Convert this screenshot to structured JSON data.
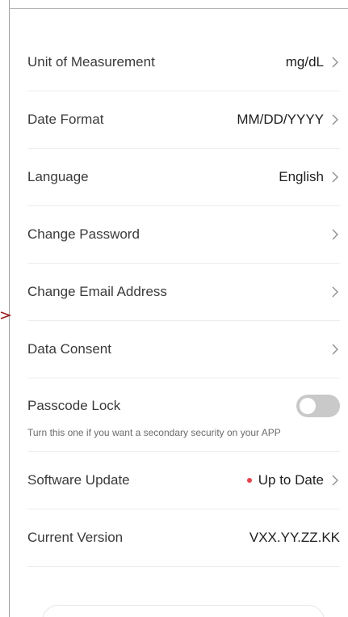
{
  "settings": {
    "rows": [
      {
        "label": "Unit of Measurement",
        "value": "mg/dL"
      },
      {
        "label": "Date Format",
        "value": "MM/DD/YYYY"
      },
      {
        "label": "Language",
        "value": "English"
      },
      {
        "label": "Change Password",
        "value": ""
      },
      {
        "label": "Change Email Address",
        "value": ""
      },
      {
        "label": "Data Consent",
        "value": ""
      }
    ],
    "passcode": {
      "label": "Passcode Lock",
      "description": "Turn this one if you want a secondary security on your APP",
      "enabled": false
    },
    "software_update": {
      "label": "Software Update",
      "status": "Up to Date",
      "status_color": "#e8424f"
    },
    "current_version": {
      "label": "Current Version",
      "value": "VXX.YY.ZZ.KK"
    }
  },
  "colors": {
    "accent_marker": "#9b1c1c",
    "toggle_off": "#c9c9c9"
  }
}
